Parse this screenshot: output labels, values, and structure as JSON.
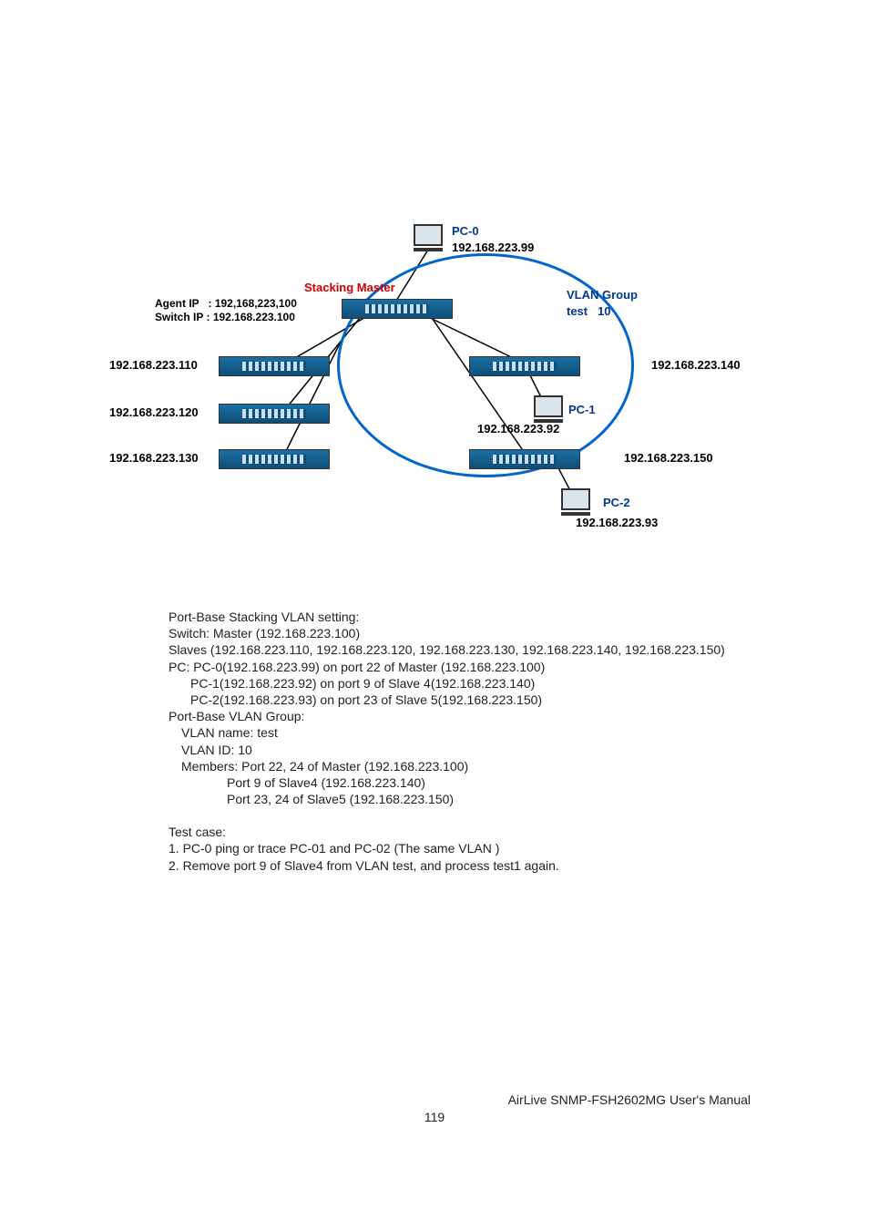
{
  "diagram": {
    "pc0": {
      "name": "PC-0",
      "ip": "192.168.223.99"
    },
    "pc1": {
      "name": "PC-1",
      "ip": "192.168.223.92"
    },
    "pc2": {
      "name": "PC-2",
      "ip": "192.168.223.93"
    },
    "master": {
      "title": "Stacking Master",
      "agent_label": "Agent IP",
      "agent_ip": ": 192,168,223,100",
      "switch_label": "Switch IP",
      "switch_ip": ": 192.168.223.100"
    },
    "left_ips": [
      "192.168.223.110",
      "192.168.223.120",
      "192.168.223.130"
    ],
    "right_ips": [
      "192.168.223.140",
      "192.168.223.150"
    ],
    "vlan_group": {
      "title": "VLAN Group",
      "name": "test",
      "id": "10"
    }
  },
  "body": {
    "l1": "Port-Base Stacking VLAN setting:",
    "l2": "Switch: Master (192.168.223.100)",
    "l3": "Slaves (192.168.223.110, 192.168.223.120, 192.168.223.130, 192.168.223.140, 192.168.223.150)",
    "l4": "PC:  PC-0(192.168.223.99) on port 22 of Master (192.168.223.100)",
    "l5": "PC-1(192.168.223.92) on port 9 of Slave 4(192.168.223.140)",
    "l6": "PC-2(192.168.223.93) on port 23 of Slave 5(192.168.223.150)",
    "l7": "Port-Base VLAN Group:",
    "l8": "VLAN name: test",
    "l9": "VLAN ID: 10",
    "l10": "Members:  Port 22, 24 of Master (192.168.223.100)",
    "l11": "Port 9    of Slave4 (192.168.223.140)",
    "l12": "Port 23, 24 of Slave5 (192.168.223.150)",
    "t1": "Test case:",
    "t2": "1. PC-0 ping or trace PC-01 and PC-02 (The same VLAN )",
    "t3": "2. Remove port 9 of Slave4 from VLAN test, and process test1 again."
  },
  "footer": {
    "right": "AirLive SNMP-FSH2602MG User's Manual",
    "page": "119"
  }
}
